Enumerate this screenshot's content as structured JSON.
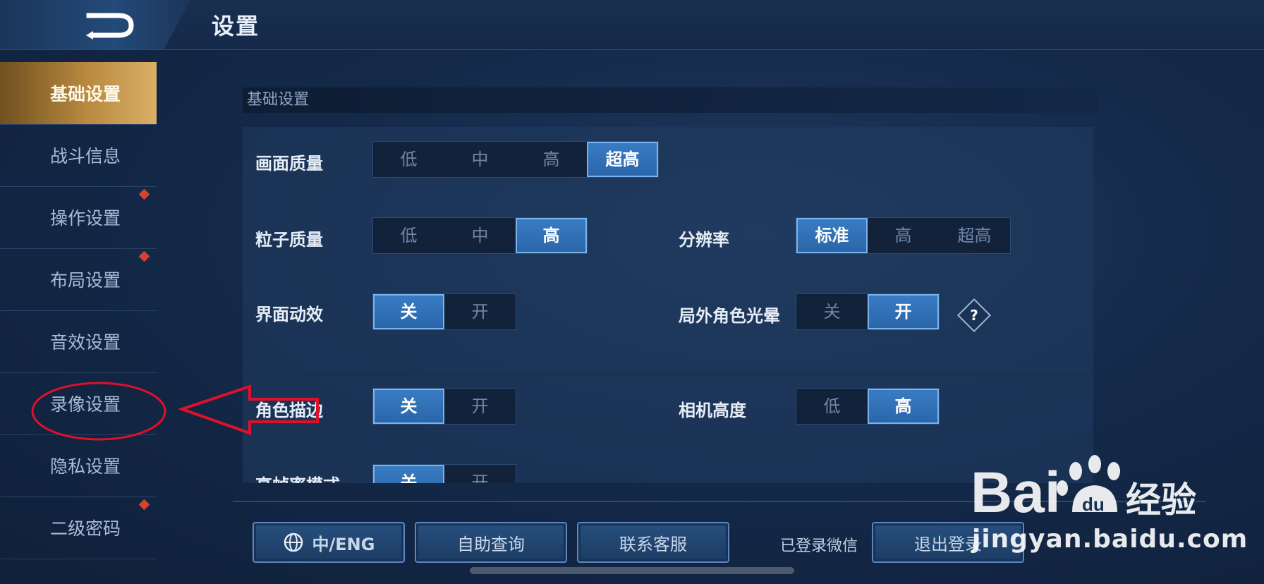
{
  "header": {
    "title": "设置",
    "back_icon": "back-arrow-icon"
  },
  "sidebar": {
    "items": [
      {
        "label": "基础设置",
        "active": true,
        "badge": false
      },
      {
        "label": "战斗信息",
        "active": false,
        "badge": false
      },
      {
        "label": "操作设置",
        "active": false,
        "badge": true
      },
      {
        "label": "布局设置",
        "active": false,
        "badge": true
      },
      {
        "label": "音效设置",
        "active": false,
        "badge": false
      },
      {
        "label": "录像设置",
        "active": false,
        "badge": false
      },
      {
        "label": "隐私设置",
        "active": false,
        "badge": false
      },
      {
        "label": "二级密码",
        "active": false,
        "badge": true
      }
    ]
  },
  "section": {
    "title": "基础设置"
  },
  "settings": {
    "graphics_quality": {
      "label": "画面质量",
      "options": [
        "低",
        "中",
        "高",
        "超高"
      ],
      "selected": 3
    },
    "particle_quality": {
      "label": "粒子质量",
      "options": [
        "低",
        "中",
        "高"
      ],
      "selected": 2
    },
    "resolution": {
      "label": "分辨率",
      "options": [
        "标准",
        "高",
        "超高"
      ],
      "selected": 0
    },
    "ui_animation": {
      "label": "界面动效",
      "options": [
        "关",
        "开"
      ],
      "selected": 0
    },
    "char_glow": {
      "label": "局外角色光晕",
      "options": [
        "关",
        "开"
      ],
      "selected": 1,
      "help": "?"
    },
    "char_outline": {
      "label": "角色描边",
      "options": [
        "关",
        "开"
      ],
      "selected": 0
    },
    "camera_height": {
      "label": "相机高度",
      "options": [
        "低",
        "高"
      ],
      "selected": 1
    },
    "high_fps": {
      "label": "高帧率模式",
      "options": [
        "关",
        "开"
      ],
      "selected": 0
    }
  },
  "footer": {
    "language": {
      "label": "中/ENG",
      "icon": "globe-icon"
    },
    "self_service": "自助查询",
    "contact": "联系客服",
    "login_status": "已登录微信",
    "logout": "退出登录"
  },
  "watermark": {
    "brand": "Bai du 经验",
    "site": "jingyan.baidu.com"
  },
  "colors": {
    "accent_blue": "#2a64a8",
    "active_gold": "#b8893f",
    "annotation_red": "#e0102a"
  }
}
